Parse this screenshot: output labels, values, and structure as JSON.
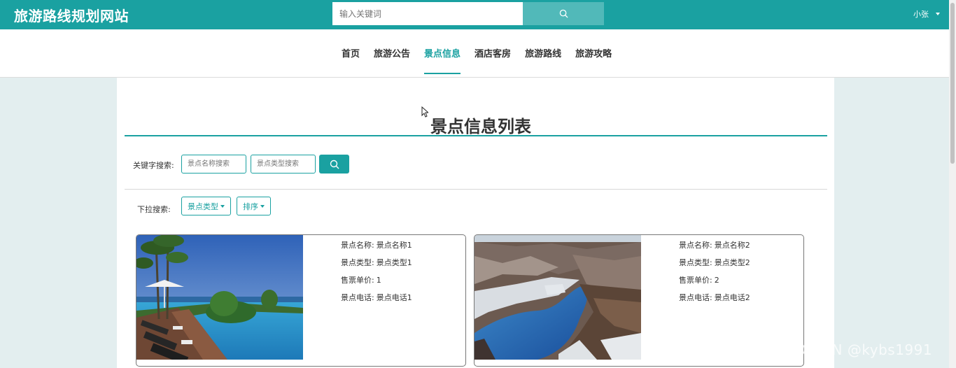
{
  "header": {
    "site_title": "旅游路线规划网站",
    "search_placeholder": "输入关键词",
    "username": "小张"
  },
  "nav": {
    "items": [
      {
        "label": "首页"
      },
      {
        "label": "旅游公告"
      },
      {
        "label": "景点信息",
        "active": true
      },
      {
        "label": "酒店客房"
      },
      {
        "label": "旅游路线"
      },
      {
        "label": "旅游攻略"
      }
    ]
  },
  "main": {
    "page_title": "景点信息列表",
    "keyword_label": "关键字搜索:",
    "name_search_placeholder": "景点名称搜索",
    "type_search_placeholder": "景点类型搜索",
    "dropdown_label": "下拉搜索:",
    "type_dropdown": "景点类型",
    "sort_dropdown": "排序"
  },
  "cards": [
    {
      "image": "resort-pool-photo",
      "name_label": "景点名称:",
      "name": "景点名称1",
      "type_label": "景点类型:",
      "type": "景点类型1",
      "price_label": "售票单价:",
      "price": "1",
      "phone_label": "景点电话:",
      "phone": "景点电话1"
    },
    {
      "image": "canyon-lake-photo",
      "name_label": "景点名称:",
      "name": "景点名称2",
      "type_label": "景点类型:",
      "type": "景点类型2",
      "price_label": "售票单价:",
      "price": "2",
      "phone_label": "景点电话:",
      "phone": "景点电话2"
    }
  ],
  "watermark": "CSDN @kybs1991",
  "colors": {
    "accent": "#1aa1a1",
    "search_button": "#51b9b9",
    "background": "#e3eeef"
  }
}
